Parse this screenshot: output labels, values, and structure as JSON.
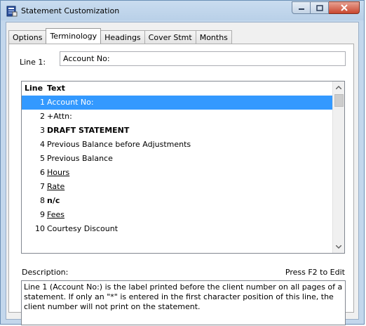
{
  "window": {
    "title": "Statement Customization"
  },
  "tabs": [
    {
      "label": "Options"
    },
    {
      "label": "Terminology"
    },
    {
      "label": "Headings"
    },
    {
      "label": "Cover Stmt"
    },
    {
      "label": "Months"
    }
  ],
  "active_tab": "Terminology",
  "line_field": {
    "label": "Line 1:",
    "value": "Account No:"
  },
  "grid": {
    "headers": {
      "line": "Line",
      "text": "Text"
    },
    "rows": [
      {
        "num": "1",
        "text": "Account No:",
        "style": "normal",
        "selected": true
      },
      {
        "num": "2",
        "text": "+Attn:",
        "style": "normal"
      },
      {
        "num": "3",
        "text": "DRAFT STATEMENT",
        "style": "bold"
      },
      {
        "num": "4",
        "text": "Previous Balance before Adjustments",
        "style": "normal"
      },
      {
        "num": "5",
        "text": "Previous Balance",
        "style": "normal"
      },
      {
        "num": "6",
        "text": "Hours",
        "style": "underline"
      },
      {
        "num": "7",
        "text": "Rate",
        "style": "underline"
      },
      {
        "num": "8",
        "text": "n/c",
        "style": "bold"
      },
      {
        "num": "9",
        "text": "Fees",
        "style": "underline"
      },
      {
        "num": "10",
        "text": "Courtesy Discount",
        "style": "normal"
      }
    ]
  },
  "description": {
    "label": "Description:",
    "hint": "Press F2 to Edit",
    "text": "Line 1 (Account No:) is the label printed before the client number on all pages of a statement.  If only an \"*\" is entered in the first character position of this line, the client number will not print on the statement."
  },
  "colors": {
    "selection": "#3399ff",
    "close_button": "#c9472f"
  }
}
